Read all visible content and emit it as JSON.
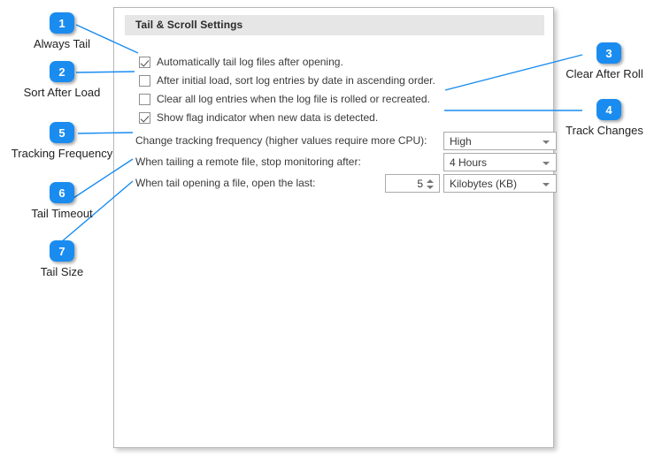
{
  "panel": {
    "header_title": "Tail & Scroll Settings",
    "checkboxes": [
      {
        "label": "Automatically tail log files after opening.",
        "checked": true
      },
      {
        "label": "After initial load, sort log entries by date in ascending order.",
        "checked": false
      },
      {
        "label": "Clear all log entries when the log file is rolled or recreated.",
        "checked": false
      },
      {
        "label": "Show flag indicator when new data is detected.",
        "checked": true
      }
    ],
    "controls": [
      {
        "label": "Change tracking frequency (higher values require more CPU):",
        "combo_value": "High"
      },
      {
        "label": "When tailing a remote file, stop monitoring after:",
        "combo_value": "4 Hours"
      },
      {
        "label": "When tail opening a file, open the last:",
        "spinner_value": "5",
        "combo_value": "Kilobytes (KB)"
      }
    ]
  },
  "callouts": [
    {
      "number": "1",
      "label": "Always Tail"
    },
    {
      "number": "2",
      "label": "Sort After Load"
    },
    {
      "number": "3",
      "label": "Clear After Roll"
    },
    {
      "number": "4",
      "label": "Track Changes"
    },
    {
      "number": "5",
      "label": "Tracking Frequency"
    },
    {
      "number": "6",
      "label": "Tail Timeout"
    },
    {
      "number": "7",
      "label": "Tail Size"
    }
  ],
  "colors": {
    "accent": "#1a8cf0",
    "panel_header_bg": "#e6e6e6",
    "panel_border": "#b7b7b7"
  }
}
